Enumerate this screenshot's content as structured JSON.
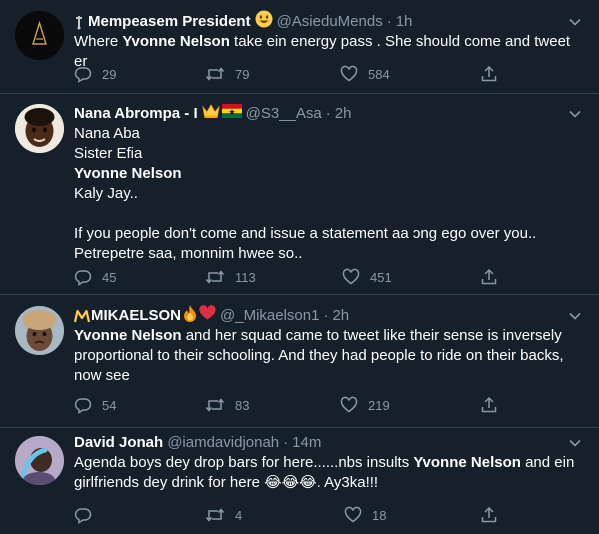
{
  "tweets": [
    {
      "name": "Mempeasem President",
      "handle": "@AsieduMends",
      "time": "1h",
      "lines": [
        {
          "pre": "Where ",
          "bold": "Yvonne Nelson",
          "post": " take ein energy pass . She should come and tweet er"
        }
      ],
      "replies": "29",
      "retweets": "79",
      "likes": "584"
    },
    {
      "name": "Nana Abrompa - I",
      "handle": "@S3__Asa",
      "time": "2h",
      "lines": [
        {
          "pre": "Nana Aba",
          "bold": "",
          "post": ""
        },
        {
          "pre": "Sister Efia",
          "bold": "",
          "post": ""
        },
        {
          "pre": "",
          "bold": "Yvonne Nelson",
          "post": ""
        },
        {
          "pre": "Kaly Jay..",
          "bold": "",
          "post": ""
        },
        {
          "pre": "",
          "bold": "",
          "post": ""
        },
        {
          "pre": "If you people don't come and issue a statement aa ɔng ego over you..",
          "bold": "",
          "post": ""
        },
        {
          "pre": "Petrepetre saa, monnim hwee so..",
          "bold": "",
          "post": ""
        }
      ],
      "replies": "45",
      "retweets": "113",
      "likes": "451"
    },
    {
      "name": "MIKAELSON",
      "handle": "@_Mikaelson1",
      "time": "2h",
      "lines": [
        {
          "pre": "",
          "bold": "Yvonne Nelson",
          "post": " and her squad came to tweet like their sense is inversely"
        },
        {
          "pre": "proportional to their schooling. And they had people to ride on their backs,",
          "bold": "",
          "post": ""
        },
        {
          "pre": "now see",
          "bold": "",
          "post": ""
        }
      ],
      "replies": "54",
      "retweets": "83",
      "likes": "219"
    },
    {
      "name": "David Jonah",
      "handle": "@iamdavidjonah",
      "time": "14m",
      "lines": [
        {
          "pre": "Agenda boys dey drop bars for here......nbs insults ",
          "bold": "Yvonne Nelson",
          "post": " and ein"
        },
        {
          "pre": "girlfriends dey drink for here ",
          "bold": "",
          "post": "😂😂😂. Ay3ka!!!"
        }
      ],
      "replies": "",
      "retweets": "4",
      "likes": "18"
    }
  ],
  "colors": {
    "background": "#15202b",
    "divider": "#38444d",
    "muted": "#8899a6",
    "text": "#ffffff"
  }
}
